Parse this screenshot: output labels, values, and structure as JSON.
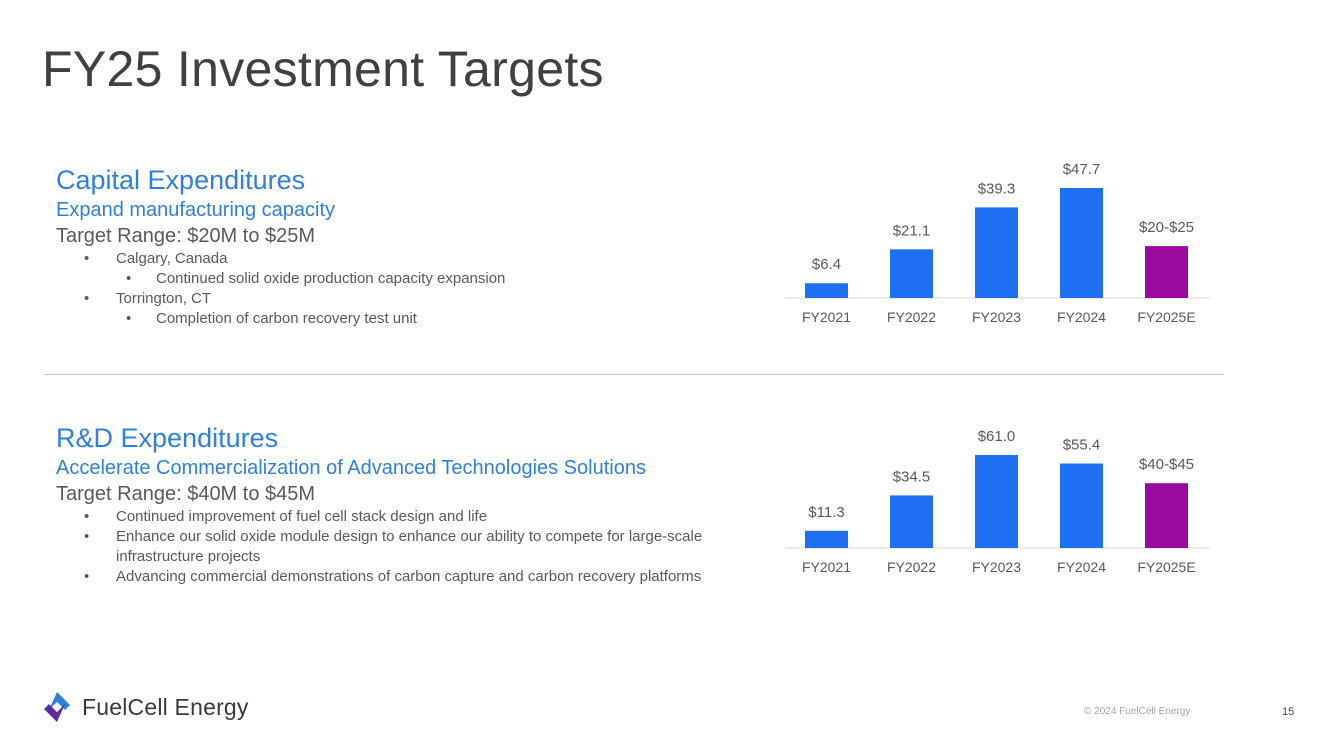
{
  "title": "FY25 Investment Targets",
  "capex": {
    "heading": "Capital Expenditures",
    "subheading": "Expand manufacturing capacity",
    "target_range": "Target Range: $20M to $25M",
    "bullets": [
      {
        "text": "Calgary, Canada",
        "level": 1
      },
      {
        "text": "Continued solid oxide production capacity expansion",
        "level": 2
      },
      {
        "text": "Torrington, CT",
        "level": 1
      },
      {
        "text": "Completion of carbon recovery test unit",
        "level": 2
      }
    ]
  },
  "rd": {
    "heading": "R&D Expenditures",
    "subheading": "Accelerate Commercialization of Advanced Technologies Solutions",
    "target_range": "Target Range: $40M to $45M",
    "bullets": [
      {
        "text": "Continued improvement of fuel cell stack design and life",
        "level": 1
      },
      {
        "text": "Enhance our solid oxide module design to enhance our ability to compete for large-scale infrastructure projects",
        "level": 1
      },
      {
        "text": "Advancing commercial demonstrations of carbon capture and carbon recovery platforms",
        "level": 1
      }
    ]
  },
  "bullet_glyph": "•",
  "chart_data": [
    {
      "type": "bar",
      "categories": [
        "FY2021",
        "FY2022",
        "FY2023",
        "FY2024",
        "FY2025E"
      ],
      "values": [
        6.4,
        21.1,
        39.3,
        47.7,
        22.5
      ],
      "data_labels": [
        "$6.4",
        "$21.1",
        "$39.3",
        "$47.7",
        "$20-$25"
      ],
      "bar_colors": [
        "#1f6ff2",
        "#1f6ff2",
        "#1f6ff2",
        "#1f6ff2",
        "#9b0aa0"
      ],
      "ylim": [
        0,
        47.7
      ],
      "grid": false,
      "legend": "none"
    },
    {
      "type": "bar",
      "categories": [
        "FY2021",
        "FY2022",
        "FY2023",
        "FY2024",
        "FY2025E"
      ],
      "values": [
        11.3,
        34.5,
        61.0,
        55.4,
        42.5
      ],
      "data_labels": [
        "$11.3",
        "$34.5",
        "$61.0",
        "$55.4",
        "$40-$45"
      ],
      "bar_colors": [
        "#1f6ff2",
        "#1f6ff2",
        "#1f6ff2",
        "#1f6ff2",
        "#9b0aa0"
      ],
      "ylim": [
        0,
        61.0
      ],
      "grid": false,
      "legend": "none"
    }
  ],
  "footer": {
    "brand": "FuelCell Energy",
    "copyright": "© 2024 FuelCell Energy",
    "page_number": "15"
  },
  "colors": {
    "accent": "#2f7fe0",
    "bar_blue": "#1f6ff2",
    "bar_purple": "#9b0aa0",
    "logo_purple": "#5a2ca0",
    "logo_blue": "#2f7fe0"
  },
  "icons": {
    "logo": "fuelcell-logo-icon"
  }
}
